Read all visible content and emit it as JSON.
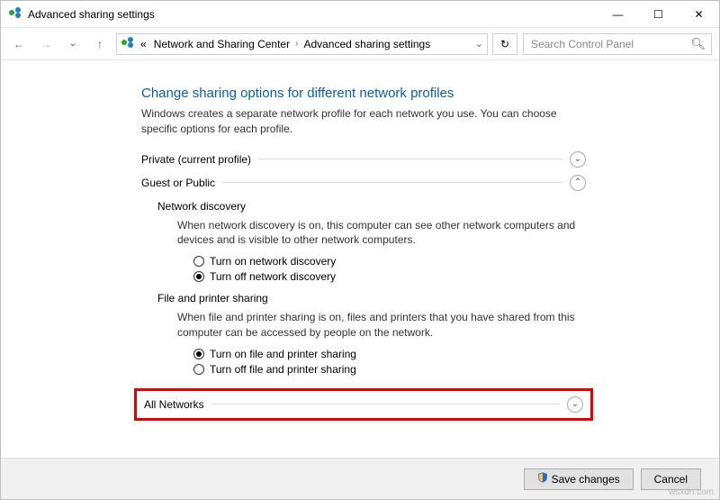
{
  "window": {
    "title": "Advanced sharing settings"
  },
  "addressbar": {
    "crumb1": "«",
    "crumb2": "Network and Sharing Center",
    "crumb3": "Advanced sharing settings"
  },
  "search": {
    "placeholder": "Search Control Panel"
  },
  "page": {
    "heading": "Change sharing options for different network profiles",
    "subtitle": "Windows creates a separate network profile for each network you use. You can choose specific options for each profile."
  },
  "sections": {
    "private": "Private (current profile)",
    "guest": "Guest or Public",
    "allnet": "All Networks"
  },
  "network_discovery": {
    "heading": "Network discovery",
    "desc": "When network discovery is on, this computer can see other network computers and devices and is visible to other network computers.",
    "opt_on": "Turn on network discovery",
    "opt_off": "Turn off network discovery"
  },
  "file_sharing": {
    "heading": "File and printer sharing",
    "desc": "When file and printer sharing is on, files and printers that you have shared from this computer can be accessed by people on the network.",
    "opt_on": "Turn on file and printer sharing",
    "opt_off": "Turn off file and printer sharing"
  },
  "footer": {
    "save": "Save changes",
    "cancel": "Cancel"
  },
  "watermark": "wsxdn.com"
}
